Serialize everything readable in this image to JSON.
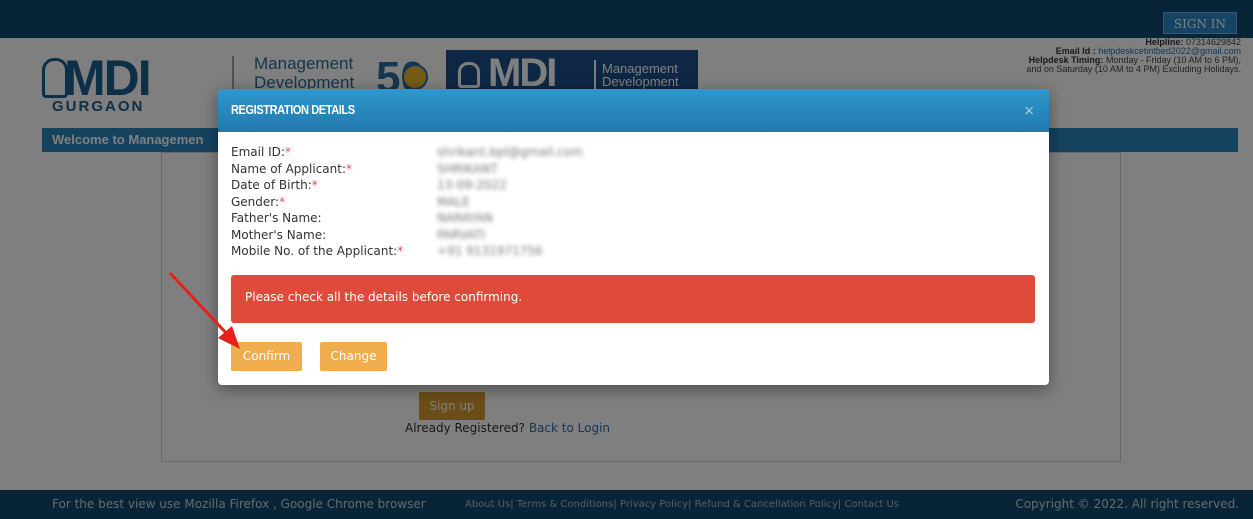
{
  "topbar": {
    "signin_label": "SIGN IN"
  },
  "header": {
    "logo_text": "MDI",
    "logo_sub": "GURGAON",
    "logo_mgmt_line1": "Management",
    "logo_mgmt_line2": "Development",
    "logo_fifty": "50",
    "box_logo_text": "MDI",
    "box_mgmt_line1": "Management",
    "box_mgmt_line2": "Development"
  },
  "helpline": {
    "helpline_label": "Helpline:",
    "helpline_value": "07314629842",
    "email_label": "Email Id :",
    "email_value": "helpdeskcetintbed2022@gmail.com",
    "timing_label": "Helpdesk Timing:",
    "timing_value": "Monday - Friday (10 AM to 6 PM),",
    "timing_line2": "and on Saturday (10 AM to 4 PM) Excluding Holidays."
  },
  "welcome": {
    "text": "Welcome to Managemen"
  },
  "form": {
    "signup_label": "Sign up",
    "already_text": "Already Registered?",
    "back_link": "Back to Login"
  },
  "footer": {
    "browser_note": "For the best view use Mozilla Firefox , Google Chrome browser",
    "links": "About Us| Terms & Conditions| Privacy Policy| Refund & Cancellation Policy| Contact Us",
    "copyright": "Copyright © 2022. All right reserved."
  },
  "modal": {
    "title": "REGISTRATION DETAILS",
    "close": "×",
    "fields": [
      {
        "label": "Email ID:",
        "required": true,
        "value": "shrikant.bpl@gmail.com"
      },
      {
        "label": "Name of Applicant:",
        "required": true,
        "value": "SHRIKANT"
      },
      {
        "label": "Date of Birth:",
        "required": true,
        "value": "13-09-2022"
      },
      {
        "label": "Gender:",
        "required": true,
        "value": "MALE"
      },
      {
        "label": "Father's Name:",
        "required": false,
        "value": "NARAYAN"
      },
      {
        "label": "Mother's Name:",
        "required": false,
        "value": "PARVATI"
      },
      {
        "label": "Mobile No. of the Applicant:",
        "required": true,
        "value": "+91 9131971756"
      }
    ],
    "alert_text": "Please check all the details before confirming.",
    "confirm_label": "Confirm",
    "change_label": "Change"
  },
  "colors": {
    "topbar": "#0e4a6e",
    "modal_header": "#2279ae",
    "alert": "#e04a3a",
    "button": "#f0ad4e",
    "annotation_arrow": "#e8201a"
  }
}
